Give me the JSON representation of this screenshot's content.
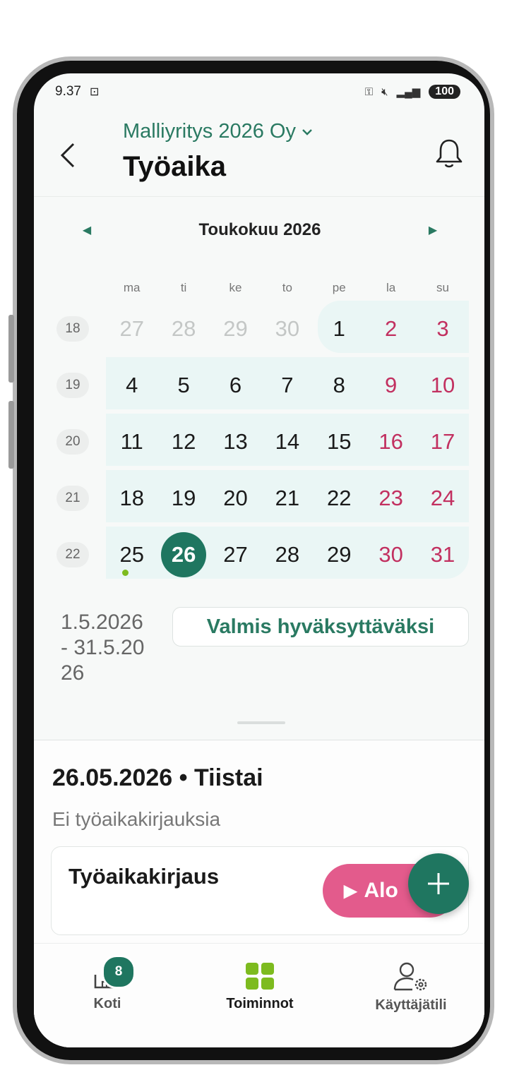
{
  "status_bar": {
    "time": "9.37",
    "battery": "100"
  },
  "header": {
    "company": "Malliyritys 2026 Oy",
    "title": "Työaika"
  },
  "calendar": {
    "month_label": "Toukokuu 2026",
    "weekday_labels": [
      "ma",
      "ti",
      "ke",
      "to",
      "pe",
      "la",
      "su"
    ],
    "weeks": [
      {
        "number": "18",
        "days": [
          "27",
          "28",
          "29",
          "30",
          "1",
          "2",
          "3"
        ]
      },
      {
        "number": "19",
        "days": [
          "4",
          "5",
          "6",
          "7",
          "8",
          "9",
          "10"
        ]
      },
      {
        "number": "20",
        "days": [
          "11",
          "12",
          "13",
          "14",
          "15",
          "16",
          "17"
        ]
      },
      {
        "number": "21",
        "days": [
          "18",
          "19",
          "20",
          "21",
          "22",
          "23",
          "24"
        ]
      },
      {
        "number": "22",
        "days": [
          "25",
          "26",
          "27",
          "28",
          "29",
          "30",
          "31"
        ]
      }
    ],
    "selected_day": "26"
  },
  "period": {
    "range": "1.5.2026\n- 31.5.20\n26",
    "ready_button": "Valmis hyväksyttäväksi"
  },
  "day_detail": {
    "date_title": "26.05.2026 • Tiistai",
    "empty_text": "Ei työaikakirjauksia",
    "card_title": "Työaikakirjaus",
    "start_button": "Alo"
  },
  "fab": {
    "icon": "plus-icon"
  },
  "tabs": [
    {
      "label": "Koti",
      "badge": "8",
      "icon": "home-icon"
    },
    {
      "label": "Toiminnot",
      "icon": "grid-icon"
    },
    {
      "label": "Käyttäjätili",
      "icon": "user-settings-icon"
    }
  ],
  "colors": {
    "primary": "#1f7660",
    "accent_pink": "#e35b8c",
    "weekend": "#c23060",
    "week_band": "#eaf6f5",
    "event_dot": "#7dbb1f"
  }
}
